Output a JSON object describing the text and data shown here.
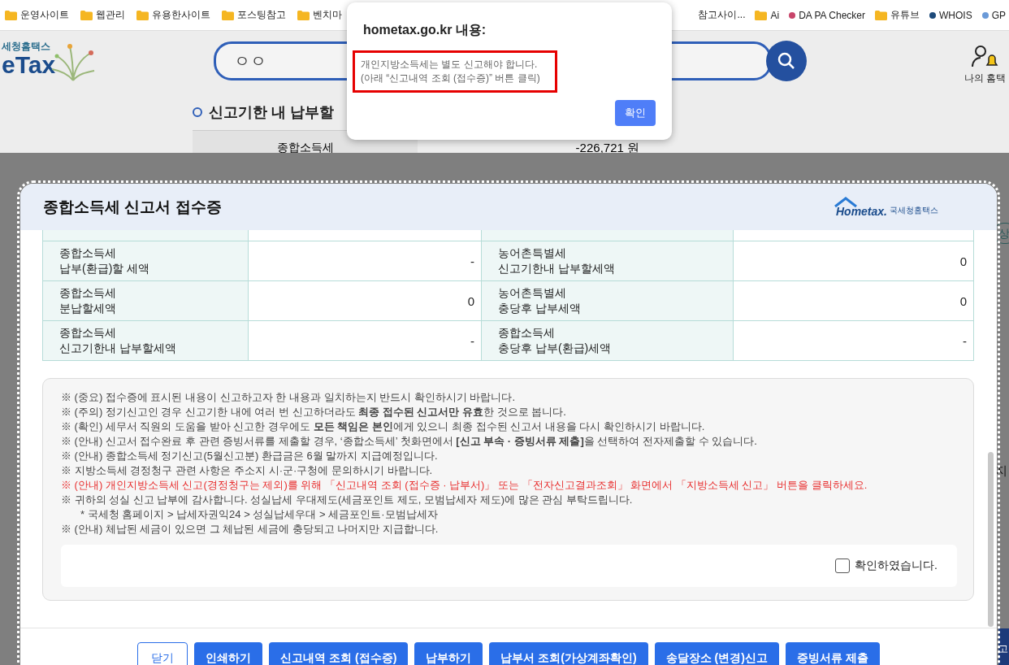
{
  "bookmarks": [
    {
      "kind": "folder",
      "label": "운영사이트"
    },
    {
      "kind": "folder",
      "label": "웹관리"
    },
    {
      "kind": "folder",
      "label": "유용한사이트"
    },
    {
      "kind": "folder",
      "label": "포스팅참고"
    },
    {
      "kind": "folder",
      "label": "벤치마"
    }
  ],
  "bookmarks_right": [
    {
      "kind": "plain",
      "label": "참고사이..."
    },
    {
      "kind": "folder",
      "label": "Ai"
    },
    {
      "kind": "site",
      "label": "DA PA Checker",
      "color": "#c8456a"
    },
    {
      "kind": "folder",
      "label": "유튜브"
    },
    {
      "kind": "site",
      "label": "WHOIS",
      "color": "#1d4a7a"
    },
    {
      "kind": "site",
      "label": "GP",
      "color": "#6a9ad8"
    }
  ],
  "page": {
    "logo_small": "세청홈택스",
    "logo_big": "eTax",
    "search_value": "ㅇㅇ",
    "my_menu": "나의 홈택",
    "heading": "신고기한 내 납부할",
    "summary_label": "종합소득세",
    "summary_value": "-226,721 원",
    "side_button": "상",
    "side_text": "지",
    "side_dark_button": "고"
  },
  "modal": {
    "title": "종합소득세 신고서 접수증",
    "logo_text": "Hometax.",
    "logo_caption": "국세청홈택스",
    "rows": [
      {
        "label_1": "종합소득세\n납부(환급)할 세액",
        "value_1": "-",
        "label_2": "농어촌특별세\n신고기한내 납부할세액",
        "value_2": "0"
      },
      {
        "label_1": "종합소득세\n분납할세액",
        "value_1": "0",
        "label_2": "농어촌특별세\n충당후 납부세액",
        "value_2": "0"
      },
      {
        "label_1": "종합소득세\n신고기한내 납부할세액",
        "value_1": "-",
        "label_2": "종합소득세\n충당후 납부(환급)세액",
        "value_2": "-"
      }
    ],
    "notices": [
      {
        "kind": "normal",
        "text": "※ (중요) 접수증에 표시된 내용이 신고하고자 한 내용과 일치하는지 반드시 확인하시기 바랍니다."
      },
      {
        "kind": "normal",
        "text": "※ (주의) 정기신고인 경우 신고기한 내에 여러 번 신고하더라도 **최종 접수된 신고서만 유효**한 것으로 봅니다."
      },
      {
        "kind": "normal",
        "text": "※ (확인) 세무서 직원의 도움을 받아 신고한 경우에도 **모든 책임은 본인**에게 있으니 최종 접수된 신고서 내용을 다시 확인하시기 바랍니다."
      },
      {
        "kind": "normal",
        "text": "※ (안내) 신고서 접수완료 후 관련 증빙서류를 제출할 경우, ‘종합소득세’ 첫화면에서 **[신고 부속 · 증빙서류 제출]**을 선택하여 전자제출할 수 있습니다."
      },
      {
        "kind": "normal",
        "text": "※ (안내) 종합소득세 정기신고(5월신고분) 환급금은 6월 말까지 지급예정입니다."
      },
      {
        "kind": "normal",
        "text": "※ 지방소득세 경정청구 관련 사항은 주소지 시·군·구청에 문의하시기 바랍니다."
      },
      {
        "kind": "warning",
        "text": "※ (안내) 개인지방소득세 신고(경정청구는 제외)를 위해 「신고내역 조회 (접수증 · 납부서)」 또는 「전자신고결과조회」 화면에서 「지방소득세 신고」 버튼을 클릭하세요."
      },
      {
        "kind": "normal",
        "text": "※ 귀하의 성실 신고 납부에 감사합니다. 성실납세 우대제도(세금포인트 제도, 모범납세자 제도)에 많은 관심 부탁드립니다."
      },
      {
        "kind": "sub",
        "text": "* 국세청 홈페이지 > 납세자권익24 > 성실납세우대 > 세금포인트·모범납세자"
      },
      {
        "kind": "normal",
        "text": "※ (안내) 체납된 세금이 있으면 그 체납된 세금에 충당되고 나머지만 지급합니다."
      }
    ],
    "confirm": {
      "label": "확인하였습니다.",
      "checked": false
    },
    "buttons": [
      {
        "kind": "outline",
        "label": "닫기"
      },
      {
        "kind": "primary",
        "label": "인쇄하기"
      },
      {
        "kind": "primary",
        "label": "신고내역 조회 (접수증)"
      },
      {
        "kind": "primary",
        "label": "납부하기"
      },
      {
        "kind": "primary",
        "label": "납부서 조회(가상계좌확인)"
      },
      {
        "kind": "primary",
        "label": "송달장소 (변경)신고"
      },
      {
        "kind": "primary",
        "label": "증빙서류 제출"
      }
    ]
  },
  "alert": {
    "title": "hometax.go.kr 내용:",
    "message": "개인지방소득세는 별도 신고해야 합니다.\n(아래 “신고내역 조회 (접수증)” 버튼 클릭)",
    "button": "확인"
  }
}
